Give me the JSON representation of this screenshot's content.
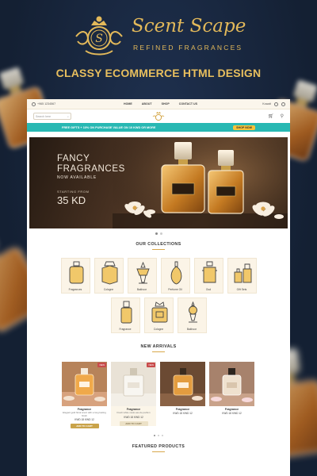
{
  "poster": {
    "brand_name": "Scent Scape",
    "brand_tagline": "REFINED FRAGRANCES",
    "emblem_letter": "S",
    "headline": "CLASSY ECOMMERCE HTML DESIGN"
  },
  "topbar": {
    "phone": "+965 1234567",
    "nav": [
      "HOME",
      "ABOUT",
      "SHOP",
      "CONTACT US"
    ],
    "currency": "Kuwait"
  },
  "header": {
    "search_placeholder": "Search here",
    "cart_count": "0"
  },
  "promo": {
    "text": "FREE GIFTS + 10% ON PURCHASE VALUE ON 10 KWD OR MORE",
    "cta": "SHOP NOW"
  },
  "hero": {
    "line1": "FANCY",
    "line2": "FRAGRANCES",
    "line3": "NOW AVAILABLE",
    "line4": "STARTING FROM",
    "price": "35 KD"
  },
  "collections": {
    "title": "OUR COLLECTIONS",
    "row1": [
      {
        "label": "Fragrances",
        "icon": "perfume-bottle-icon"
      },
      {
        "label": "Cologne",
        "icon": "cologne-bottle-icon"
      },
      {
        "label": "Bakhoor",
        "icon": "bakhoor-burner-icon"
      },
      {
        "label": "Perfume Oil",
        "icon": "oil-bottle-icon"
      },
      {
        "label": "Oud",
        "icon": "oud-bottle-icon"
      },
      {
        "label": "Gift Sets",
        "icon": "gift-set-icon"
      }
    ],
    "row2": [
      {
        "label": "Fragrance",
        "icon": "slim-bottle-icon"
      },
      {
        "label": "Cologne",
        "icon": "crown-bottle-icon"
      },
      {
        "label": "Bakhoor",
        "icon": "incense-burner-icon"
      }
    ]
  },
  "arrivals": {
    "title": "NEW ARRIVALS",
    "products": [
      {
        "name": "Fragrance",
        "desc": "Elegant gold floral scent with a long lasting finish",
        "price": "KWD 18   KWD 12",
        "badge": "NEW",
        "cta": "ADD TO CART"
      },
      {
        "name": "Fragrance",
        "desc": "Fresh white musk eau de parfum",
        "price": "KWD 18   KWD 12",
        "badge": "NEW",
        "cta": "ADD TO CART"
      },
      {
        "name": "Fragrance",
        "desc": "",
        "price": "KWD 18   KWD 12",
        "badge": "",
        "cta": ""
      },
      {
        "name": "Fragrance",
        "desc": "",
        "price": "KWD 18   KWD 12",
        "badge": "",
        "cta": ""
      }
    ]
  },
  "featured": {
    "title": "FEATURED PRODUCTS"
  },
  "colors": {
    "poster_bg": "#17253a",
    "gold": "#e3b95a",
    "teal": "#28b8b3",
    "button_gold": "#c9a34a"
  }
}
